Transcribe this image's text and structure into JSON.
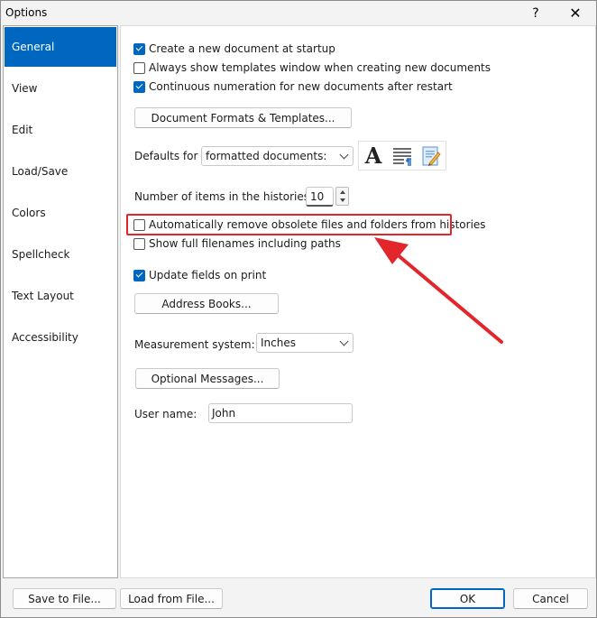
{
  "window": {
    "title": "Options",
    "help_label": "?",
    "close_label": "✕"
  },
  "sidebar": {
    "items": [
      {
        "label": "General",
        "active": true
      },
      {
        "label": "View",
        "active": false
      },
      {
        "label": "Edit",
        "active": false
      },
      {
        "label": "Load/Save",
        "active": false
      },
      {
        "label": "Colors",
        "active": false
      },
      {
        "label": "Spellcheck",
        "active": false
      },
      {
        "label": "Text Layout",
        "active": false
      },
      {
        "label": "Accessibility",
        "active": false
      }
    ]
  },
  "general": {
    "checkboxes": [
      {
        "label": "Create a new document at startup",
        "checked": true
      },
      {
        "label": "Always show templates window when creating new documents",
        "checked": false
      },
      {
        "label": "Continuous numeration for new documents after restart",
        "checked": true
      },
      {
        "label": "Automatically remove obsolete files and folders from histories",
        "checked": false
      },
      {
        "label": "Show full filenames including paths",
        "checked": false
      },
      {
        "label": "Update fields on print",
        "checked": true
      }
    ],
    "doc_formats_button": "Document Formats & Templates...",
    "defaults_for_label": "Defaults for",
    "defaults_for_value": "formatted documents:",
    "icons": [
      "font-icon",
      "paragraph-format-icon",
      "document-edit-icon"
    ],
    "font_icon_glyph": "A",
    "histories_label": "Number of items in the histories:",
    "histories_value": "10",
    "address_books_button": "Address Books...",
    "measurement_label": "Measurement system:",
    "measurement_value": "Inches",
    "optional_messages_button": "Optional Messages...",
    "user_name_label": "User name:",
    "user_name_value": "John"
  },
  "footer": {
    "save_to_file": "Save to File...",
    "load_from_file": "Load from File...",
    "ok": "OK",
    "cancel": "Cancel"
  },
  "colors": {
    "accent": "#0067c0",
    "annotation_red": "#e3262c"
  }
}
